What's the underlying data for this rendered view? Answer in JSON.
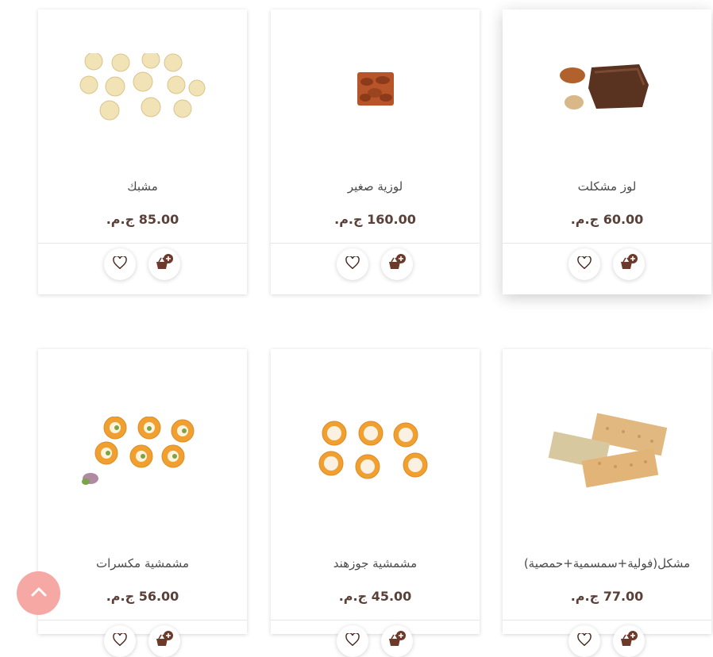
{
  "products": [
    {
      "name": "مشبك",
      "price": "85.00 ج.م."
    },
    {
      "name": "لوزية صغير",
      "price": "160.00 ج.م."
    },
    {
      "name": "لوز مشكلت",
      "price": "60.00 ج.م."
    },
    {
      "name": "مشمشية مكسرات",
      "price": "56.00 ج.م."
    },
    {
      "name": "مشمشية جوزهند",
      "price": "45.00 ج.م."
    },
    {
      "name": "مشكل(فولية+سمسمية+حمصية)",
      "price": "77.00 ج.م."
    }
  ],
  "icons": {
    "wishlist": "heart-icon",
    "cart": "basket-add-icon",
    "scroll_top": "chevron-up-icon"
  },
  "colors": {
    "accent": "#6b3a2a",
    "scroll_top_bg": "#f6a8a4",
    "price_text": "#5a4038"
  }
}
